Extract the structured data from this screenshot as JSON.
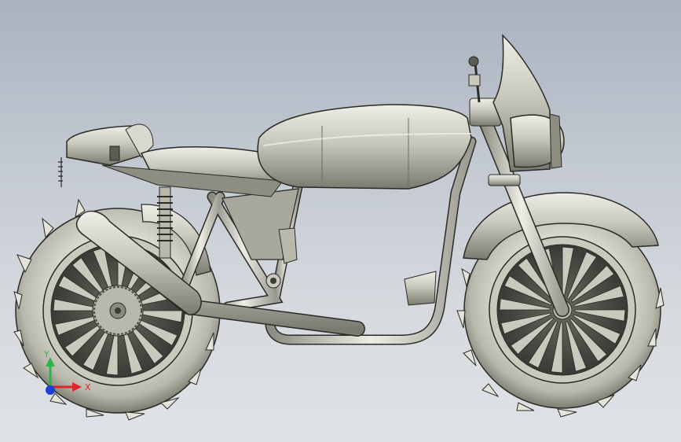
{
  "viewport": {
    "background_top": "#a9b2bf",
    "background_bottom": "#dfe2e6",
    "model": "motorcycle-3d-model",
    "view": "right side"
  },
  "triad": {
    "x_label": "X",
    "y_label": "Y",
    "x_color": "#e0242b",
    "y_color": "#2db34a",
    "z_color": "#1d3fd8"
  },
  "colors": {
    "metal": "#c9c9bd",
    "metal_dark": "#6d6d63",
    "edge": "#2a2a26"
  }
}
